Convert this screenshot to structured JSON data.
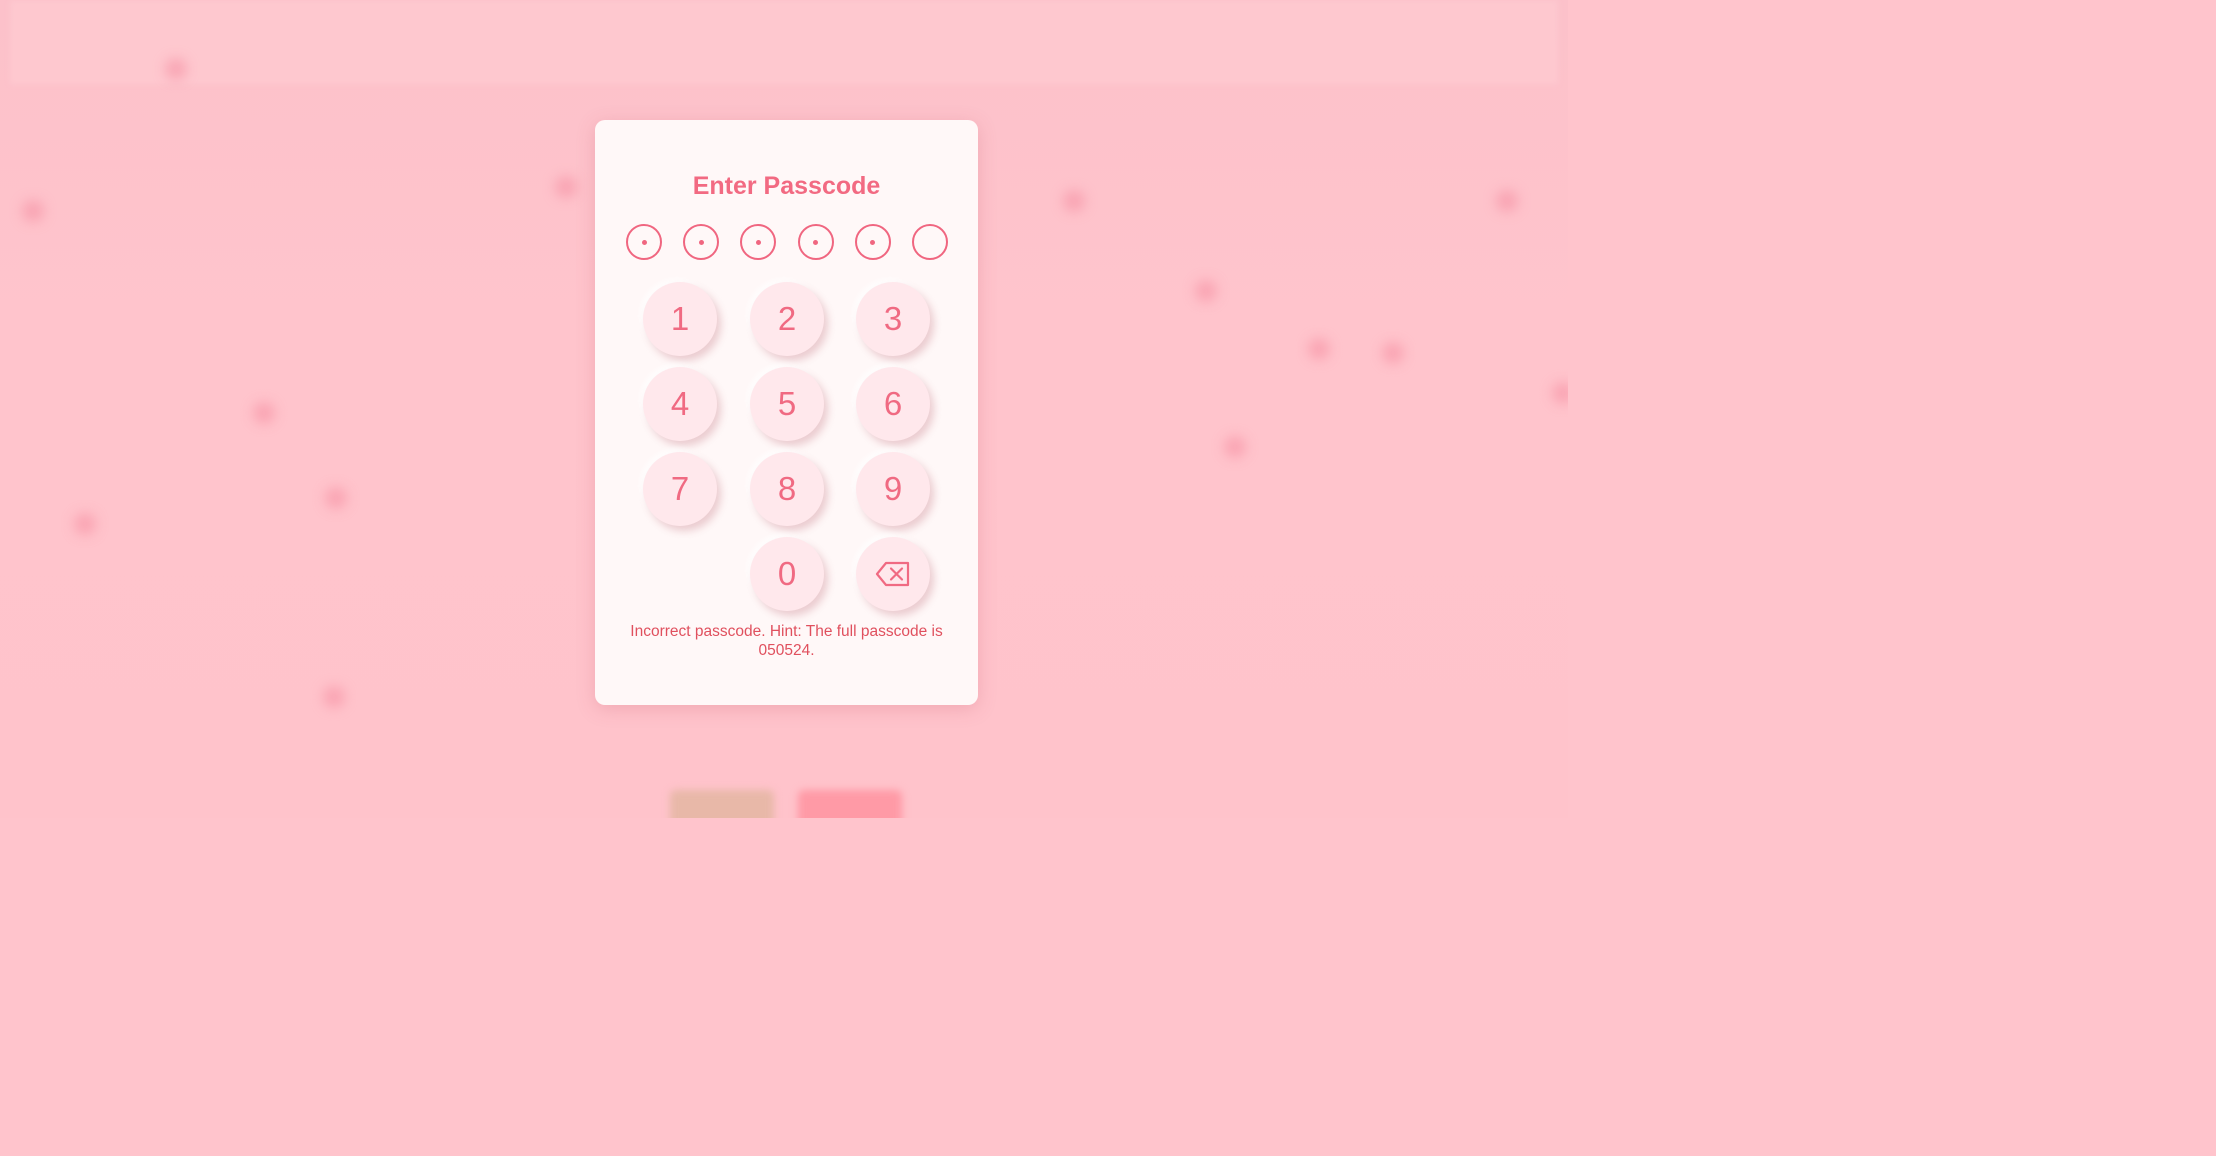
{
  "modal": {
    "title": "Enter Passcode",
    "digits_entered": 5,
    "digits_total": 6,
    "keys": [
      "1",
      "2",
      "3",
      "4",
      "5",
      "6",
      "7",
      "8",
      "9",
      "0"
    ],
    "backspace_icon": "backspace-icon",
    "error_message": "Incorrect passcode. Hint: The full passcode is 050524."
  },
  "colors": {
    "accent": "#f06a82",
    "error": "#e0505e",
    "background": "#ffc4cc",
    "key_bg": "#ffe8ec",
    "modal_bg": "#fff8f8"
  }
}
